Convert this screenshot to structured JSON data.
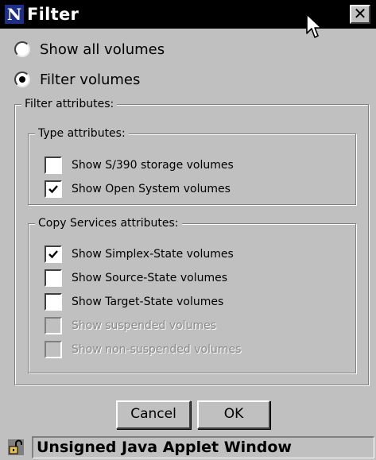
{
  "window": {
    "title": "Filter",
    "logo_letter": "N",
    "close_glyph": "✕"
  },
  "options": {
    "show_all": {
      "label": "Show all volumes",
      "selected": false
    },
    "filter": {
      "label": "Filter volumes",
      "selected": true
    }
  },
  "filter_attributes": {
    "title": "Filter attributes:",
    "type_attributes": {
      "title": "Type attributes:",
      "items": [
        {
          "label": "Show S/390 storage volumes",
          "checked": false,
          "enabled": true
        },
        {
          "label": "Show Open System volumes",
          "checked": true,
          "enabled": true
        }
      ]
    },
    "copy_services": {
      "title": "Copy Services attributes:",
      "items": [
        {
          "label": "Show Simplex-State volumes",
          "checked": true,
          "enabled": true
        },
        {
          "label": "Show Source-State volumes",
          "checked": false,
          "enabled": true
        },
        {
          "label": "Show Target-State volumes",
          "checked": false,
          "enabled": true
        },
        {
          "label": "Show suspended volumes",
          "checked": false,
          "enabled": false
        },
        {
          "label": "Show non-suspended volumes",
          "checked": false,
          "enabled": false
        }
      ]
    }
  },
  "buttons": {
    "cancel": "Cancel",
    "ok": "OK"
  },
  "status": {
    "text": "Unsigned Java Applet Window",
    "icon": "unlocked-icon"
  }
}
